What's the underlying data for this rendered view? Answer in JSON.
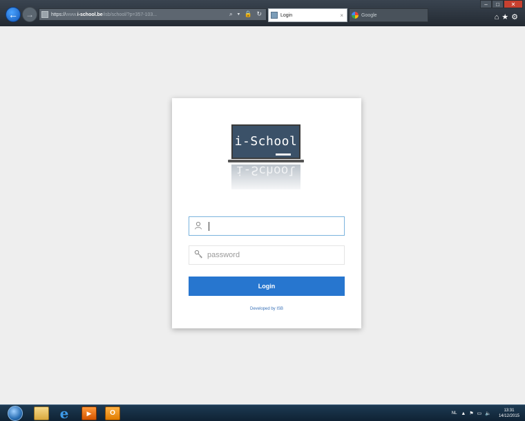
{
  "browser": {
    "url_protocol": "https://",
    "url_prefix": "www.",
    "url_domain": "i-school.be",
    "url_path": "/isb/school/?p=357-103...",
    "tabs": [
      {
        "label": "Login",
        "active": true
      },
      {
        "label": "Google",
        "active": false
      }
    ],
    "tab_close_glyph": "×",
    "address_icons": "⌕ ▾ 🔒 ↻"
  },
  "login": {
    "logo_text": "i-School",
    "username_placeholder": "",
    "password_placeholder": "password",
    "button_label": "Login",
    "developer_credit": "Developed by ISB"
  },
  "taskbar": {
    "language": "NL",
    "time": "13:31",
    "date": "14/12/2015"
  },
  "colors": {
    "primary_button": "#2776cf",
    "chalkboard": "#3b5168",
    "focused_border": "#7ab3dd"
  },
  "icons": [
    "back-arrow-icon",
    "forward-arrow-icon",
    "search-icon",
    "lock-icon",
    "refresh-icon",
    "user-icon",
    "key-icon",
    "home-icon",
    "star-icon",
    "gear-icon"
  ]
}
